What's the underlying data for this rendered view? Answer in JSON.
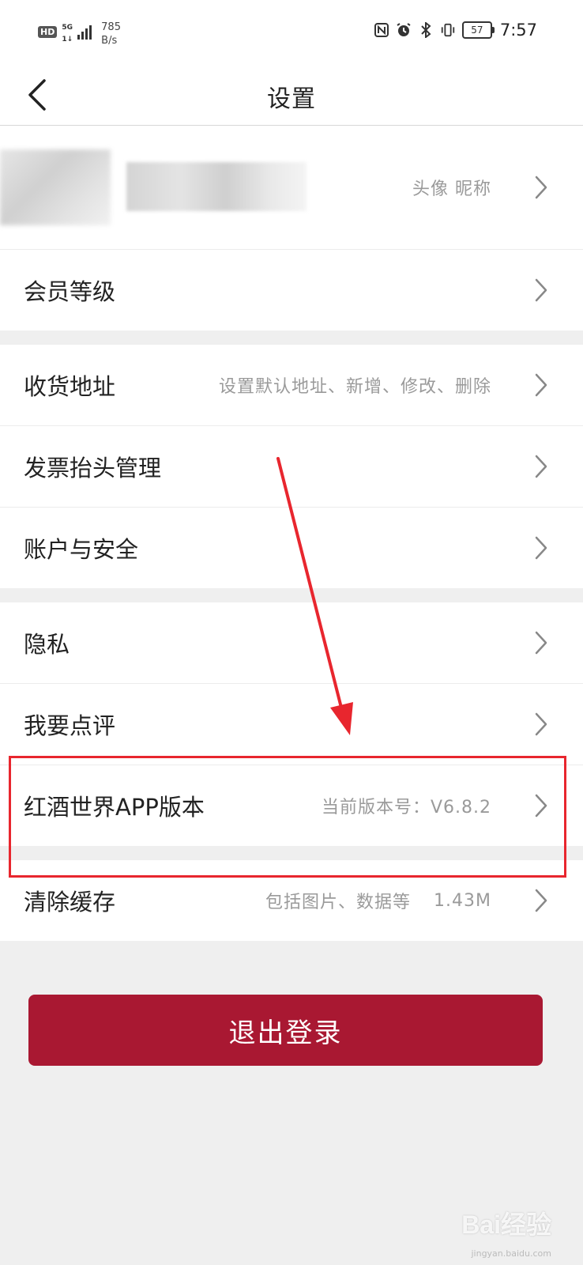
{
  "status_bar": {
    "hd": "HD",
    "network": "5G",
    "network_sub": "1↓",
    "speed_value": "785",
    "speed_unit": "B/s",
    "battery": "57",
    "time": "7:57"
  },
  "nav": {
    "title": "设置"
  },
  "profile": {
    "hint": "头像 昵称"
  },
  "rows": {
    "member": {
      "label": "会员等级"
    },
    "address": {
      "label": "收货地址",
      "hint": "设置默认地址、新增、修改、删除"
    },
    "invoice": {
      "label": "发票抬头管理"
    },
    "account": {
      "label": "账户与安全"
    },
    "privacy": {
      "label": "隐私"
    },
    "review": {
      "label": "我要点评"
    },
    "version": {
      "label": "红酒世界APP版本",
      "hint": "当前版本号：V6.8.2"
    },
    "cache": {
      "label": "清除缓存",
      "hint": "包括图片、数据等",
      "size": "1.43M"
    }
  },
  "logout_label": "退出登录",
  "watermark": {
    "brand": "Bai经验",
    "url": "jingyan.baidu.com"
  },
  "colors": {
    "logout_bg": "#a91832",
    "highlight": "#e8262e",
    "arrow": "#e8262e"
  }
}
